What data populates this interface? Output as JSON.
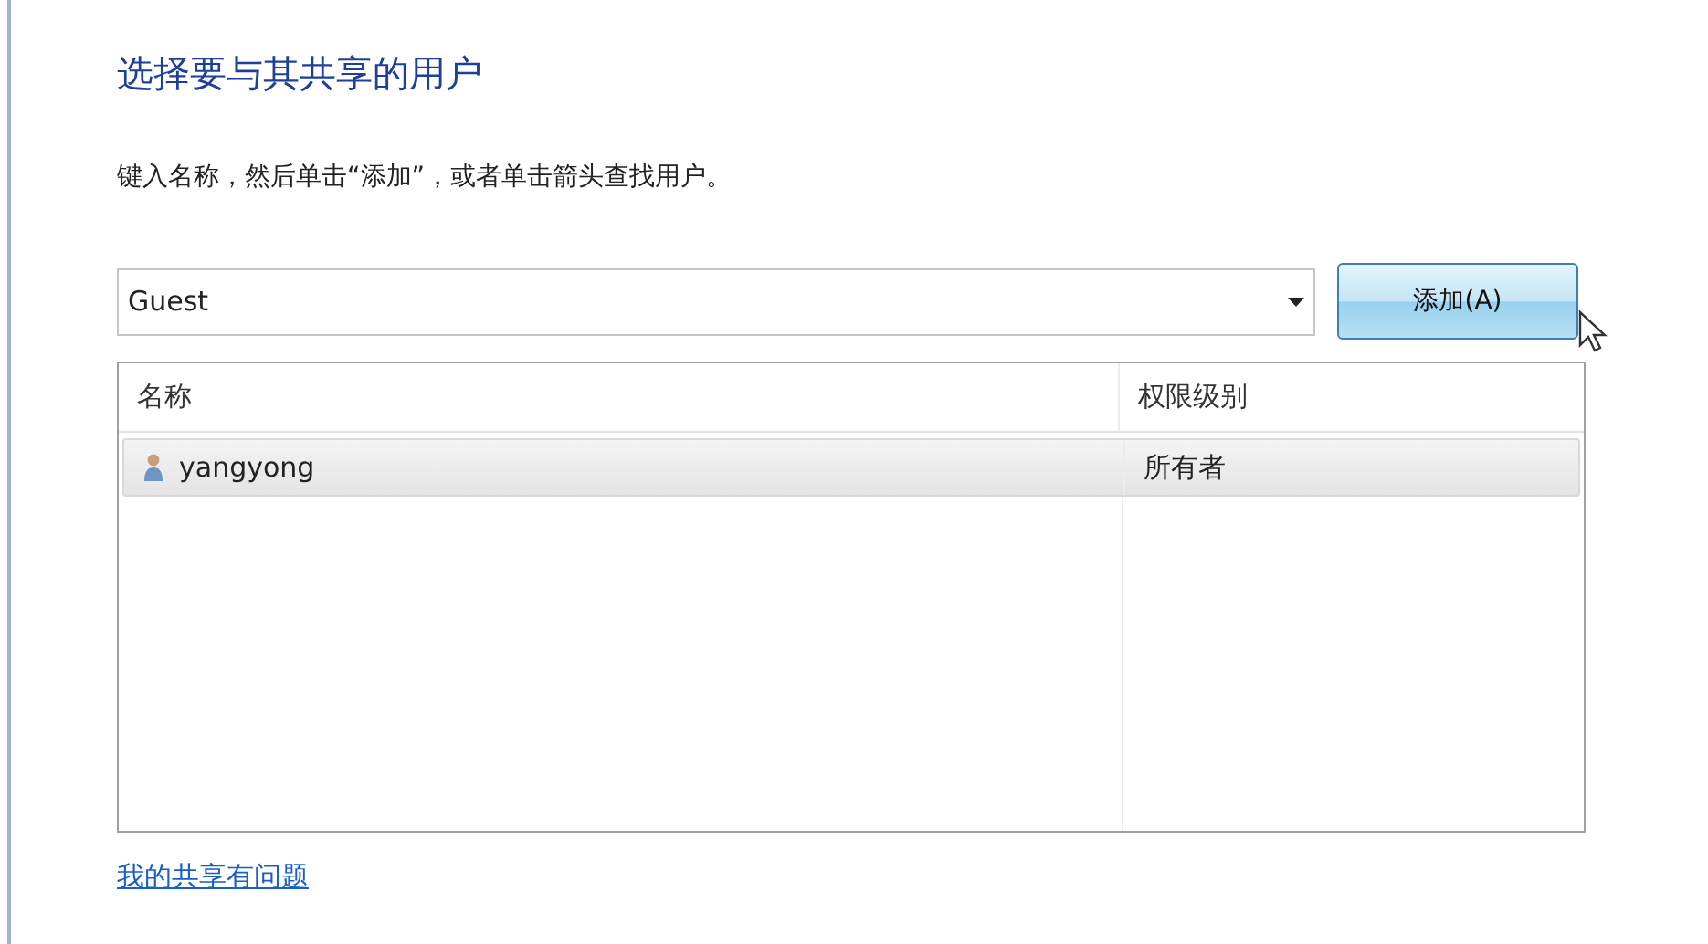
{
  "title": "选择要与其共享的用户",
  "instruction": "键入名称，然后单击“添加”，或者单击箭头查找用户。",
  "name_field": {
    "value": "Guest"
  },
  "add_button": "添加(A)",
  "table": {
    "columns": [
      "名称",
      "权限级别"
    ],
    "rows": [
      {
        "name": "yangyong",
        "permission": "所有者",
        "selected": true
      }
    ]
  },
  "help_link": "我的共享有问题"
}
